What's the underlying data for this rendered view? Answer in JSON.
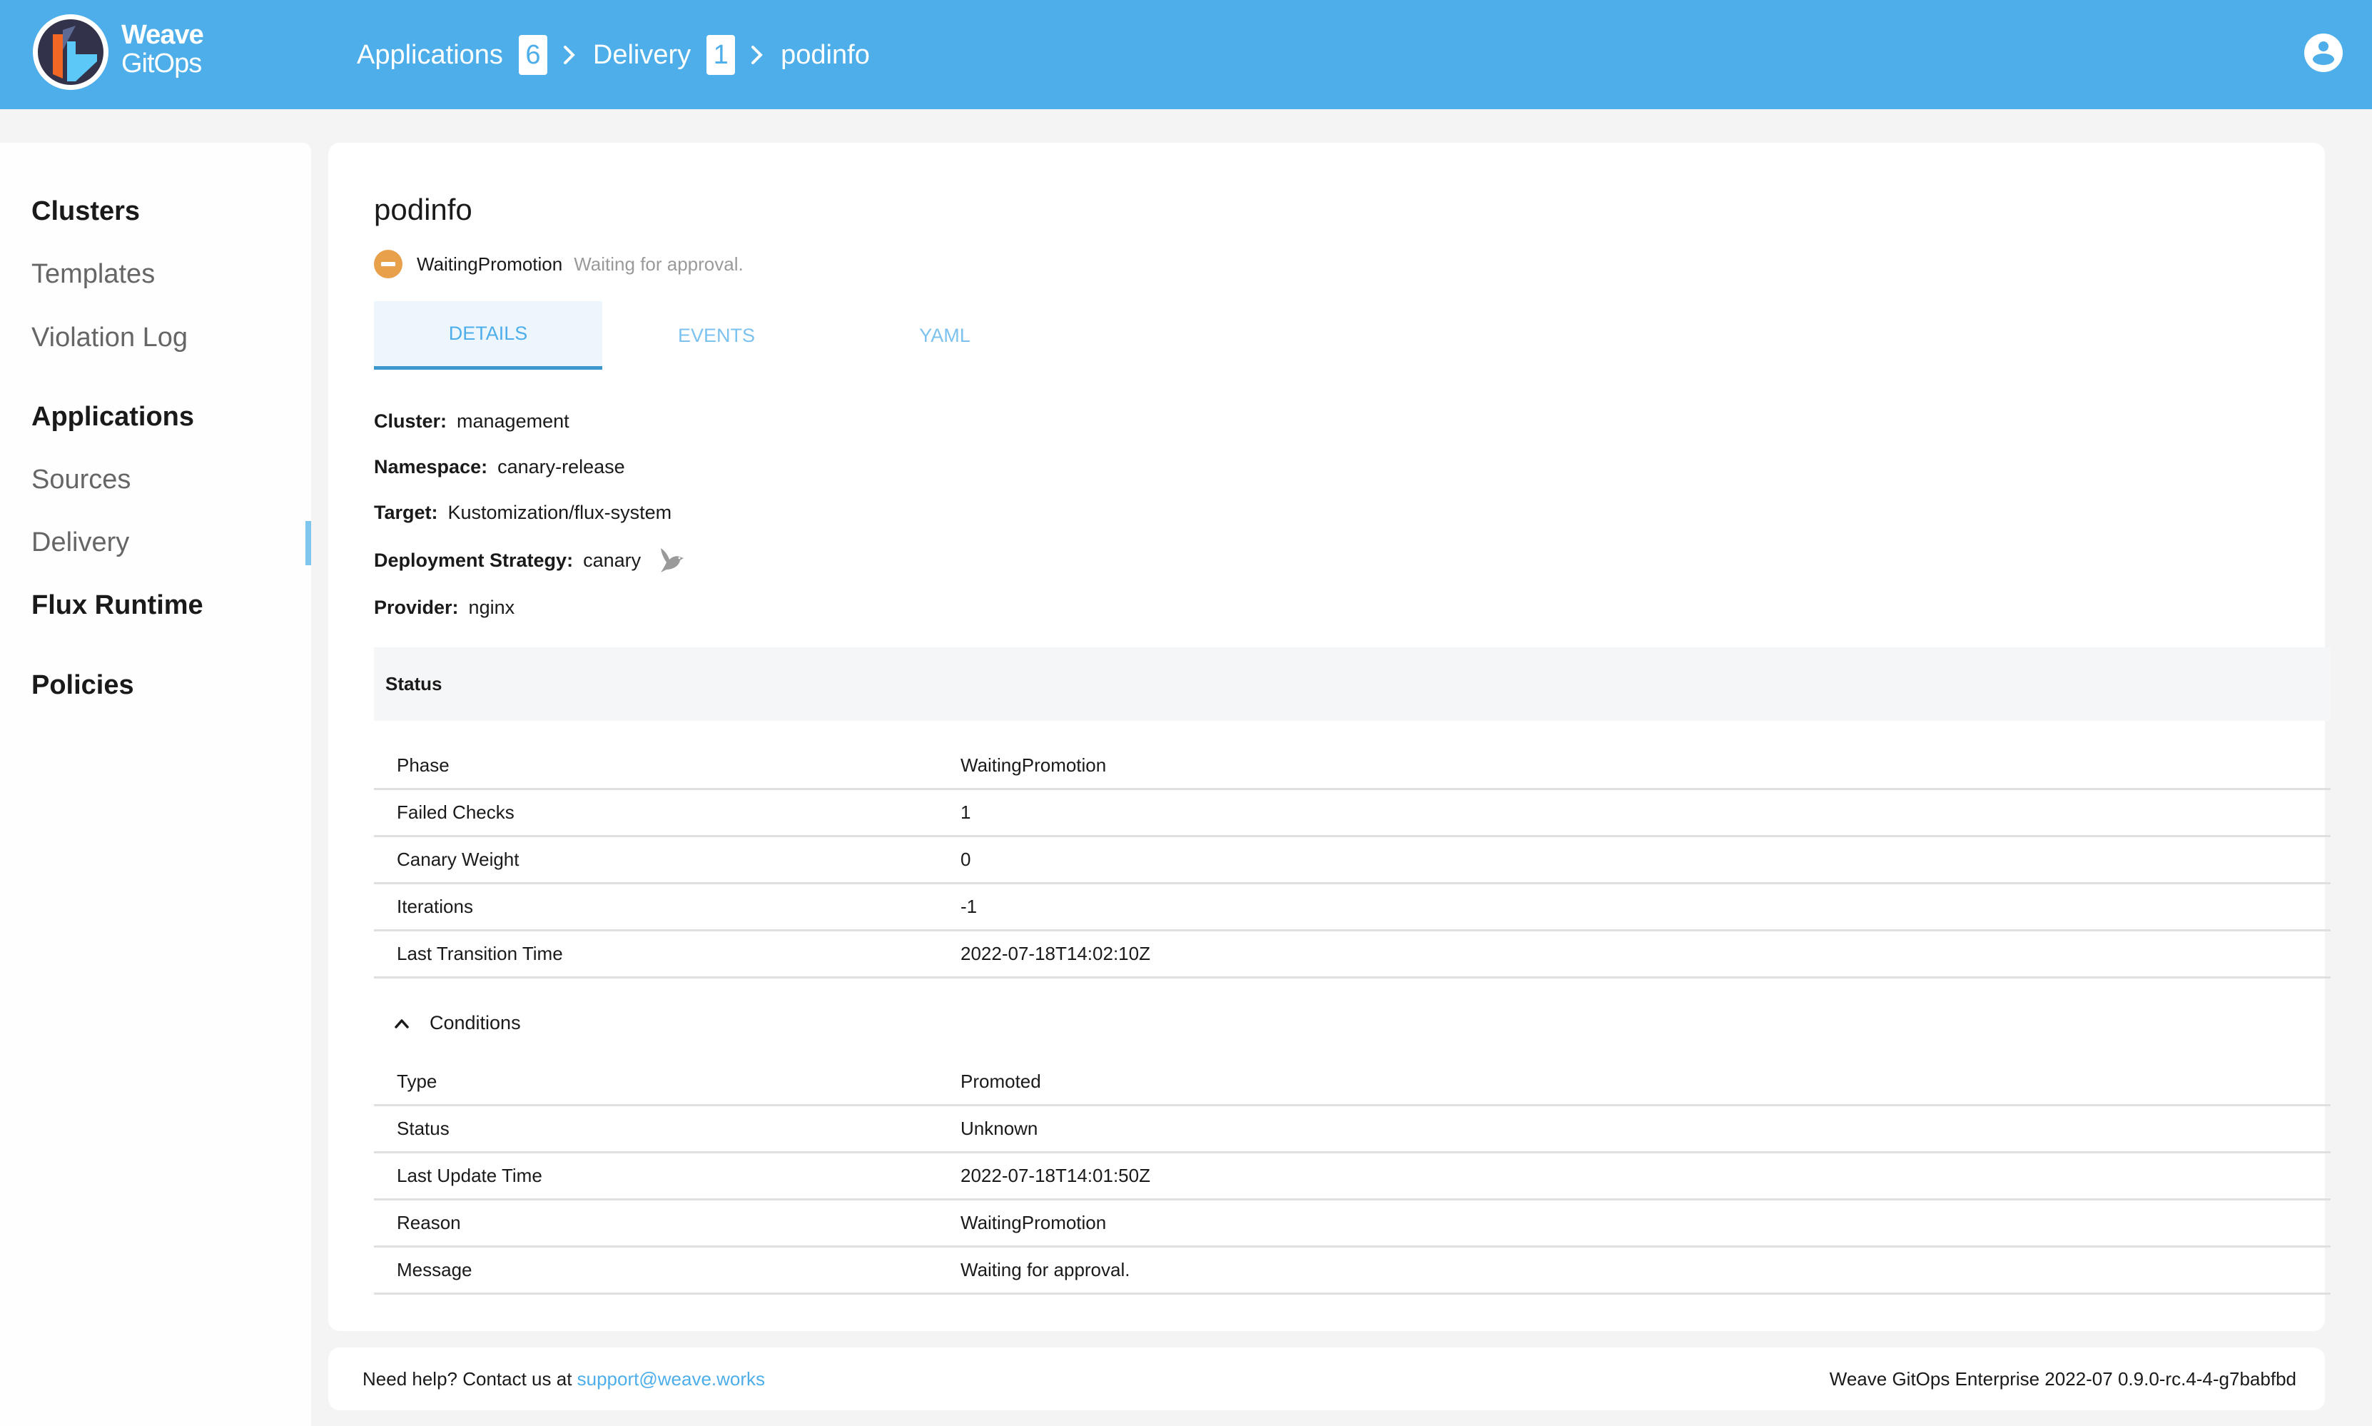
{
  "header": {
    "brand_line1": "Weave",
    "brand_line2": "GitOps",
    "breadcrumbs": [
      {
        "label": "Applications",
        "count": "6"
      },
      {
        "label": "Delivery",
        "count": "1"
      }
    ],
    "current": "podinfo",
    "icons": {
      "logo": "weave-gitops-logo",
      "user": "account-circle-icon",
      "separator": "chevron-right-icon"
    },
    "colors": {
      "header_bg": "#4eaeea"
    }
  },
  "sidebar": {
    "items": [
      {
        "label": "Clusters",
        "type": "group"
      },
      {
        "label": "Templates",
        "type": "sub"
      },
      {
        "label": "Violation Log",
        "type": "sub"
      },
      {
        "label": "Applications",
        "type": "group"
      },
      {
        "label": "Sources",
        "type": "sub"
      },
      {
        "label": "Delivery",
        "type": "sub",
        "active": true
      },
      {
        "label": "Flux Runtime",
        "type": "group"
      },
      {
        "label": "Policies",
        "type": "group"
      }
    ]
  },
  "main": {
    "title": "podinfo",
    "status": {
      "phase": "WaitingPromotion",
      "message": "Waiting for approval.",
      "icon": "minus-circle-icon",
      "color": "#e8a04b"
    },
    "tabs": [
      {
        "label": "DETAILS",
        "active": true
      },
      {
        "label": "EVENTS",
        "active": false
      },
      {
        "label": "YAML",
        "active": false
      }
    ],
    "info": [
      {
        "key": "Cluster:",
        "value": "management"
      },
      {
        "key": "Namespace:",
        "value": "canary-release"
      },
      {
        "key": "Target:",
        "value": "Kustomization/flux-system"
      },
      {
        "key": "Deployment Strategy:",
        "value": "canary",
        "icon": "canary-bird-icon"
      },
      {
        "key": "Provider:",
        "value": "nginx"
      }
    ],
    "status_section": {
      "title": "Status",
      "rows": [
        {
          "key": "Phase",
          "value": "WaitingPromotion"
        },
        {
          "key": "Failed Checks",
          "value": "1"
        },
        {
          "key": "Canary Weight",
          "value": "0"
        },
        {
          "key": "Iterations",
          "value": "-1"
        },
        {
          "key": "Last Transition Time",
          "value": "2022-07-18T14:02:10Z"
        }
      ]
    },
    "conditions": {
      "label": "Conditions",
      "expanded": true,
      "rows": [
        {
          "key": "Type",
          "value": "Promoted"
        },
        {
          "key": "Status",
          "value": "Unknown"
        },
        {
          "key": "Last Update Time",
          "value": "2022-07-18T14:01:50Z"
        },
        {
          "key": "Reason",
          "value": "WaitingPromotion"
        },
        {
          "key": "Message",
          "value": "Waiting for approval."
        }
      ]
    }
  },
  "footer": {
    "help_text": "Need help? Contact us at ",
    "support_email": "support@weave.works",
    "version": "Weave GitOps Enterprise 2022-07 0.9.0-rc.4-4-g7babfbd"
  }
}
